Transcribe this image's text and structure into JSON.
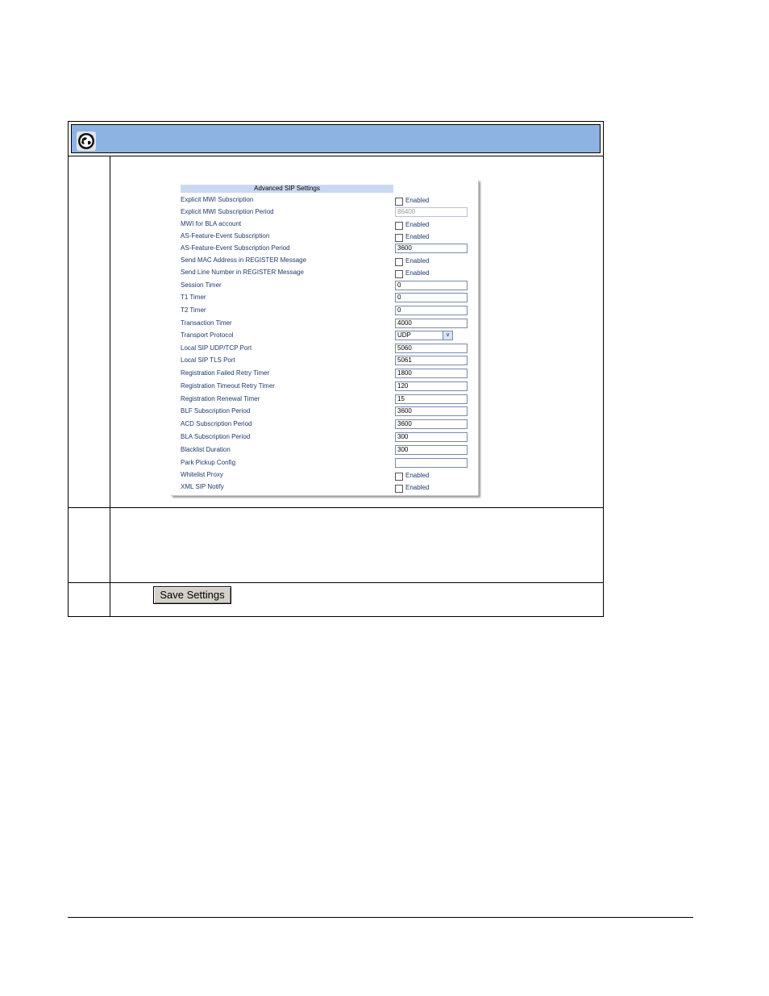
{
  "panel": {
    "title": "Advanced SIP Settings",
    "rows": [
      {
        "label": "Explicit MWI Subscription",
        "type": "checkbox",
        "text": "Enabled"
      },
      {
        "label": "Explicit MWI Subscription Period",
        "type": "input",
        "value": "86400",
        "disabled": true
      },
      {
        "label": "MWI for BLA account",
        "type": "checkbox",
        "text": "Enabled"
      },
      {
        "label": "AS-Feature-Event Subscription",
        "type": "checkbox",
        "text": "Enabled"
      },
      {
        "label": "AS-Feature-Event Subscription Period",
        "type": "input",
        "value": "3600"
      },
      {
        "label": "Send MAC Address in REGISTER Message",
        "type": "checkbox",
        "text": "Enabled"
      },
      {
        "label": "Send Line Number in REGISTER Message",
        "type": "checkbox",
        "text": "Enabled"
      },
      {
        "label": "Session Timer",
        "type": "input",
        "value": "0"
      },
      {
        "label": "T1 Timer",
        "type": "input",
        "value": "0"
      },
      {
        "label": "T2 Timer",
        "type": "input",
        "value": "0"
      },
      {
        "label": "Transaction Timer",
        "type": "input",
        "value": "4000"
      },
      {
        "label": "Transport Protocol",
        "type": "select",
        "value": "UDP"
      },
      {
        "label": "Local SIP UDP/TCP Port",
        "type": "input",
        "value": "5060"
      },
      {
        "label": "Local SIP TLS Port",
        "type": "input",
        "value": "5061"
      },
      {
        "label": "Registration Failed Retry Timer",
        "type": "input",
        "value": "1800"
      },
      {
        "label": "Registration Timeout Retry Timer",
        "type": "input",
        "value": "120"
      },
      {
        "label": "Registration Renewal Timer",
        "type": "input",
        "value": "15"
      },
      {
        "label": "BLF Subscription Period",
        "type": "input",
        "value": "3600"
      },
      {
        "label": "ACD Subscription Period",
        "type": "input",
        "value": "3600"
      },
      {
        "label": "BLA Subscription Period",
        "type": "input",
        "value": "300"
      },
      {
        "label": "Blacklist Duration",
        "type": "input",
        "value": "300"
      },
      {
        "label": "Park Pickup Config",
        "type": "input",
        "value": ""
      },
      {
        "label": "Whitelist Proxy",
        "type": "checkbox",
        "text": "Enabled"
      },
      {
        "label": "XML SIP Notify",
        "type": "checkbox",
        "text": "Enabled"
      }
    ]
  },
  "save_button": {
    "label": "Save Settings"
  },
  "icons": {
    "header": "globe-icon",
    "select_arrow": "chevron-down-icon"
  },
  "colors": {
    "header_band": "#8db3e2",
    "panel_title": "#c9d9f1",
    "label_text": "#1f3a6b"
  }
}
